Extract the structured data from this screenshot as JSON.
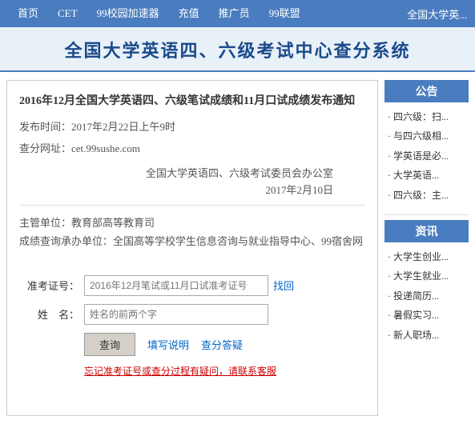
{
  "nav": {
    "items": [
      {
        "label": "首页",
        "href": "#"
      },
      {
        "label": "CET",
        "href": "#"
      },
      {
        "label": "99校园加速器",
        "href": "#"
      },
      {
        "label": "充值",
        "href": "#"
      },
      {
        "label": "推广员",
        "href": "#"
      },
      {
        "label": "99联盟",
        "href": "#"
      }
    ],
    "right_label": "全国大学英..."
  },
  "site_title": "全国大学英语四、六级考试中心查分系统",
  "notice": {
    "title": "2016年12月全国大学英语四、六级笔试成绩和11月口试成绩发布通知",
    "publish_time_label": "发布时间：2017年2月22日上午9时",
    "query_url_label": "查分网址：cet.99sushe.com",
    "org": "全国大学英语四、六级考试委员会办公室",
    "date": "2017年2月10日",
    "responsible1": "主管单位：教育部高等教育司",
    "responsible2": "成绩查询承办单位：全国高等学校学生信息咨询与就业指导中心、99宿舍网"
  },
  "form": {
    "exam_id_label": "准考证号：",
    "exam_id_placeholder": "2016年12月笔试或11月口试准考证号",
    "find_label": "找回",
    "name_label": "姓　名：",
    "name_placeholder": "姓名的前两个字",
    "query_btn": "查询",
    "fill_instructions": "填写说明",
    "score_faq": "查分答疑",
    "forgot_text": "忘记准考证号或查分过程有疑问，请联系客服"
  },
  "sidebar": {
    "announcement_heading": "公告",
    "announcement_items": [
      "四六级：扫...",
      "与四六级相...",
      "学英语是必...",
      "大学英语...",
      "四六级：主..."
    ],
    "news_heading": "资讯",
    "news_items": [
      "大学生创业...",
      "大学生就业...",
      "投递简历...",
      "暑假实习...",
      "新人职场..."
    ]
  }
}
